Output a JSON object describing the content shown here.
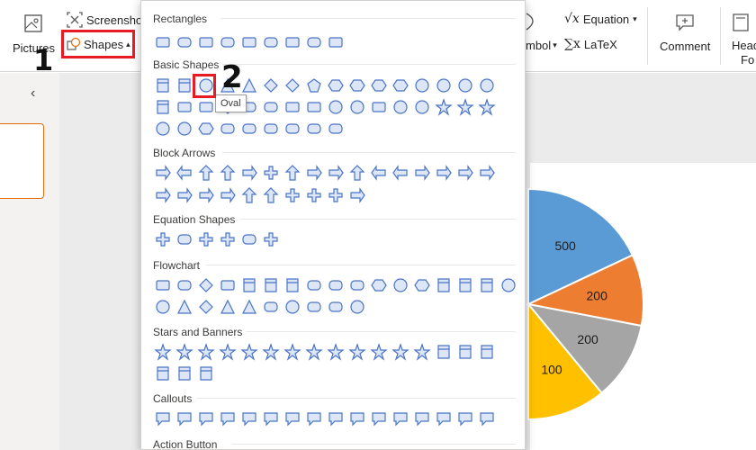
{
  "ribbon": {
    "pictures_label": "Pictures",
    "screenshot_label": "Screenshot",
    "shapes_label": "Shapes",
    "symbol_label": "mbol",
    "equation_label": "Equation",
    "latex_label": "LaTeX",
    "comment_label": "Comment",
    "header_footer_label": "Head",
    "header_footer_label_2": "Fo"
  },
  "annotations": {
    "step1": "1",
    "step2": "2"
  },
  "tooltip": "Oval",
  "gallery": {
    "sections": [
      "Rectangles",
      "Basic Shapes",
      "Block Arrows",
      "Equation Shapes",
      "Flowchart",
      "Stars and Banners",
      "Callouts",
      "Action Button"
    ]
  },
  "chart_data": {
    "type": "pie",
    "values": [
      500,
      200,
      200,
      100
    ],
    "labels": [
      "500",
      "200",
      "200",
      "100"
    ],
    "colors": [
      "#5b9bd5",
      "#ed7d31",
      "#a5a5a5",
      "#ffc000"
    ],
    "note": "partially visible; only these slices shown"
  },
  "colors": {
    "shape_fill": "#dce6f7",
    "shape_stroke": "#4a74c6",
    "highlight": "#e51c23",
    "thumb_border": "#e46c0a"
  }
}
